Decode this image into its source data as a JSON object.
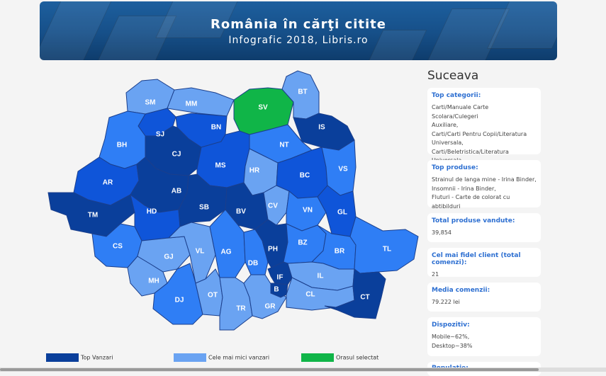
{
  "banner": {
    "title": "România în cărţi citite",
    "subtitle": "Infografic 2018, Libris.ro"
  },
  "colors": {
    "top": "#0a3f9b",
    "dark": "#0f55d9",
    "mid": "#2f7ef5",
    "light": "#6aa3f2",
    "selected": "#10b548"
  },
  "map": {
    "regions": [
      {
        "code": "SM",
        "shade": "light"
      },
      {
        "code": "MM",
        "shade": "light"
      },
      {
        "code": "SV",
        "shade": "selected"
      },
      {
        "code": "BT",
        "shade": "light"
      },
      {
        "code": "SJ",
        "shade": "dark"
      },
      {
        "code": "BN",
        "shade": "dark"
      },
      {
        "code": "IS",
        "shade": "top"
      },
      {
        "code": "BH",
        "shade": "mid"
      },
      {
        "code": "CJ",
        "shade": "top"
      },
      {
        "code": "NT",
        "shade": "mid"
      },
      {
        "code": "MS",
        "shade": "dark"
      },
      {
        "code": "HR",
        "shade": "light"
      },
      {
        "code": "BC",
        "shade": "dark"
      },
      {
        "code": "VS",
        "shade": "mid"
      },
      {
        "code": "AR",
        "shade": "dark"
      },
      {
        "code": "AB",
        "shade": "top"
      },
      {
        "code": "TM",
        "shade": "top"
      },
      {
        "code": "HD",
        "shade": "dark"
      },
      {
        "code": "SB",
        "shade": "top"
      },
      {
        "code": "BV",
        "shade": "top"
      },
      {
        "code": "CV",
        "shade": "light"
      },
      {
        "code": "VN",
        "shade": "mid"
      },
      {
        "code": "GL",
        "shade": "dark"
      },
      {
        "code": "CS",
        "shade": "mid"
      },
      {
        "code": "GJ",
        "shade": "light"
      },
      {
        "code": "VL",
        "shade": "light"
      },
      {
        "code": "AG",
        "shade": "mid"
      },
      {
        "code": "DB",
        "shade": "mid"
      },
      {
        "code": "PH",
        "shade": "top"
      },
      {
        "code": "BZ",
        "shade": "mid"
      },
      {
        "code": "BR",
        "shade": "mid"
      },
      {
        "code": "TL",
        "shade": "mid"
      },
      {
        "code": "MH",
        "shade": "light"
      },
      {
        "code": "DJ",
        "shade": "mid"
      },
      {
        "code": "OT",
        "shade": "light"
      },
      {
        "code": "TR",
        "shade": "light"
      },
      {
        "code": "GR",
        "shade": "light"
      },
      {
        "code": "IF",
        "shade": "top"
      },
      {
        "code": "B",
        "shade": "top"
      },
      {
        "code": "IL",
        "shade": "light"
      },
      {
        "code": "CL",
        "shade": "light"
      },
      {
        "code": "CT",
        "shade": "top"
      }
    ]
  },
  "legend": {
    "top_label": "Top Vanzari",
    "low_label": "Cele mai mici vanzari",
    "selected_label": "Orasul selectat"
  },
  "sidebar": {
    "county": "Suceava",
    "cards": [
      {
        "title": "Top categorii:",
        "lines": [
          "Carti/Manuale Carte Scolara/Culegeri",
          "Auxiliare,",
          "Carti/Carti Pentru Copii/Literatura",
          "Universala,",
          "Carti/Beletristica/Literatura Universala"
        ]
      },
      {
        "title": "Top produse:",
        "lines": [
          "Strainul de langa mine - Irina Binder,",
          "Insomnii - Irina Binder,",
          "Fluturi - Carte de colorat cu abtibilduri"
        ]
      },
      {
        "title": "Total produse vandute:",
        "lines": [
          "39,854"
        ]
      },
      {
        "title": "Cel mai fidel client (total comenzi):",
        "lines": [
          "21"
        ]
      },
      {
        "title": "Media comenzii:",
        "lines": [
          "79.222 lei"
        ]
      },
      {
        "title": "Dispozitiv:",
        "lines": [
          "Mobile~62%,",
          "Desktop~38%"
        ]
      },
      {
        "title": "Populatie:",
        "lines": []
      }
    ]
  }
}
